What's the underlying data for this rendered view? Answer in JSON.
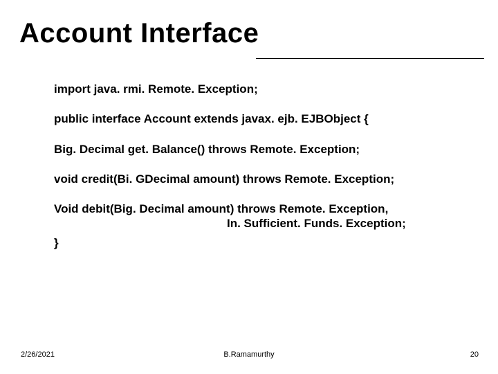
{
  "title": "Account Interface",
  "code": {
    "line1": "import java. rmi. Remote. Exception;",
    "line2": "public interface Account extends javax. ejb. EJBObject {",
    "line3": "Big. Decimal get. Balance() throws Remote. Exception;",
    "line4": "void credit(Bi. GDecimal amount) throws Remote. Exception;",
    "line5a": "Void debit(Big. Decimal amount) throws Remote. Exception,",
    "line5b": "In. Sufficient. Funds. Exception;",
    "line6": "}"
  },
  "footer": {
    "date": "2/26/2021",
    "author": "B.Ramamurthy",
    "page": "20"
  }
}
